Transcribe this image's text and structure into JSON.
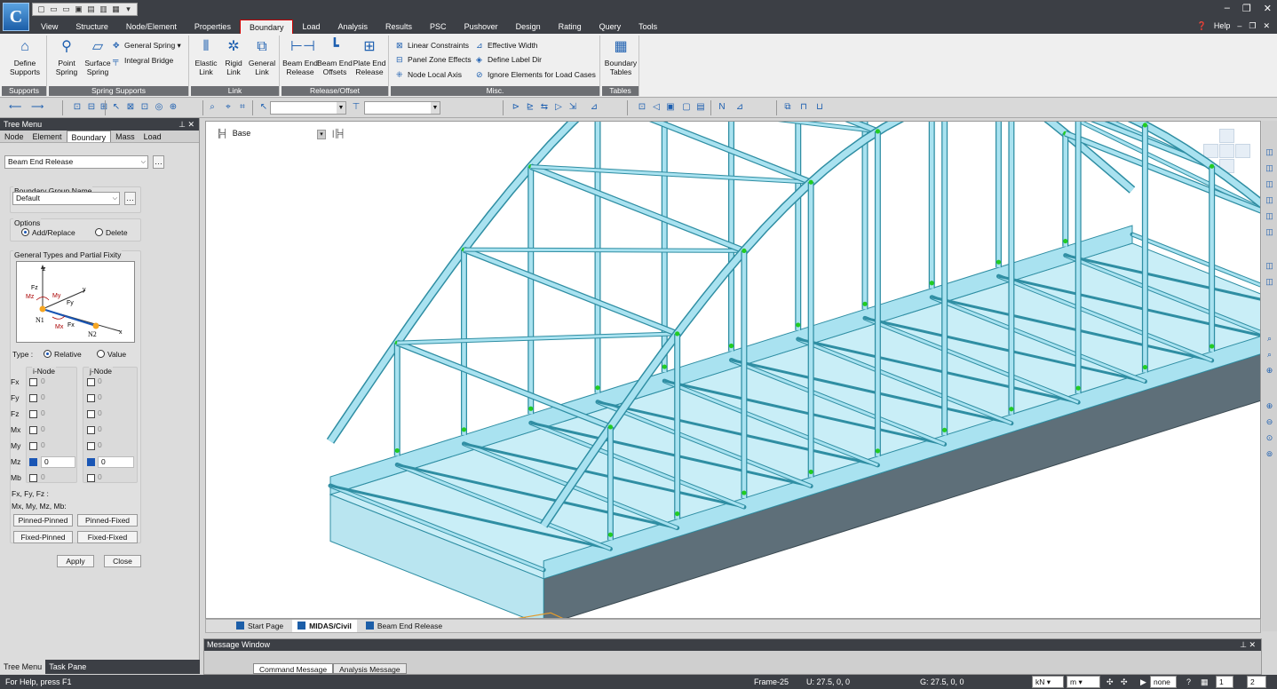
{
  "menubar": {
    "logo": "C",
    "tabs": [
      "View",
      "Structure",
      "Node/Element",
      "Properties",
      "Boundary",
      "Load",
      "Analysis",
      "Results",
      "PSC",
      "Pushover",
      "Design",
      "Rating",
      "Query",
      "Tools"
    ],
    "active_tab": "Boundary",
    "help": "Help"
  },
  "ribbon": {
    "supports": {
      "group": "Supports",
      "define_supports": "Define Supports"
    },
    "spring": {
      "group": "Spring Supports",
      "point_spring": "Point Spring",
      "surface_spring": "Surface Spring",
      "general_spring": "General Spring",
      "integral_bridge": "Integral Bridge"
    },
    "link": {
      "group": "Link",
      "elastic": "Elastic Link",
      "rigid": "Rigid Link",
      "general": "General Link"
    },
    "release": {
      "group": "Release/Offset",
      "beam_end_release": "Beam End Release",
      "beam_end_offsets": "Beam End Offsets",
      "plate_end_release": "Plate End Release"
    },
    "misc": {
      "group": "Misc.",
      "linear_constraints": "Linear Constraints",
      "panel_zone": "Panel Zone Effects",
      "node_local_axis": "Node Local Axis",
      "effective_width": "Effective Width",
      "define_label_dir": "Define Label Dir",
      "ignore_elements": "Ignore Elements for Load Cases"
    },
    "tables": {
      "group": "Tables",
      "boundary_tables": "Boundary Tables"
    }
  },
  "tree_menu": {
    "title": "Tree Menu",
    "tabs": [
      "Node",
      "Element",
      "Boundary",
      "Mass",
      "Load"
    ],
    "active_tab": "Boundary",
    "function": "Beam End Release",
    "group_label": "Boundary Group Name",
    "group_value": "Default",
    "options_label": "Options",
    "add_replace": "Add/Replace",
    "delete": "Delete",
    "fixity_label": "General Types and Partial Fixity",
    "diagram": {
      "z": "z",
      "y": "y",
      "x": "x",
      "fz": "Fz",
      "my": "My",
      "mz": "Mz",
      "fy": "Fy",
      "mx": "Mx",
      "fx": "Fx",
      "n1": "N1",
      "n2": "N2"
    },
    "type_label": "Type :",
    "relative": "Relative",
    "value": "Value",
    "i_node": "i-Node",
    "j_node": "j-Node",
    "rows": [
      {
        "label": "Fx",
        "i": "0",
        "j": "0"
      },
      {
        "label": "Fy",
        "i": "0",
        "j": "0"
      },
      {
        "label": "Fz",
        "i": "0",
        "j": "0"
      },
      {
        "label": "Mx",
        "i": "0",
        "j": "0"
      },
      {
        "label": "My",
        "i": "0",
        "j": "0"
      },
      {
        "label": "Mz",
        "i": "0",
        "j": "0"
      },
      {
        "label": "Mb",
        "i": "0",
        "j": "0"
      }
    ],
    "legend1": "Fx, Fy, Fz    :",
    "legend2": "Mx, My, Mz, Mb:",
    "pinned_pinned": "Pinned-Pinned",
    "pinned_fixed": "Pinned-Fixed",
    "fixed_pinned": "Fixed-Pinned",
    "fixed_fixed": "Fixed-Fixed",
    "apply": "Apply",
    "close": "Close",
    "bottom_tabs": [
      "Tree Menu",
      "Task Pane"
    ]
  },
  "viewport": {
    "view_name": "Base"
  },
  "doc_tabs": [
    "Start Page",
    "MIDAS/Civil",
    "Beam End Release"
  ],
  "message_window": {
    "title": "Message Window",
    "tabs": [
      "Command Message",
      "Analysis Message"
    ]
  },
  "status": {
    "help": "For Help, press F1",
    "frame": "Frame-25",
    "u": "U: 27.5, 0, 0",
    "g": "G: 27.5, 0, 0",
    "force_unit": "kN",
    "length_unit": "m",
    "none": "none",
    "page": "2"
  },
  "colors": {
    "member": "#a9e2f0",
    "member_edge": "#2f8ea3",
    "shadow": "#5e6f79",
    "node": "#22cc22"
  }
}
